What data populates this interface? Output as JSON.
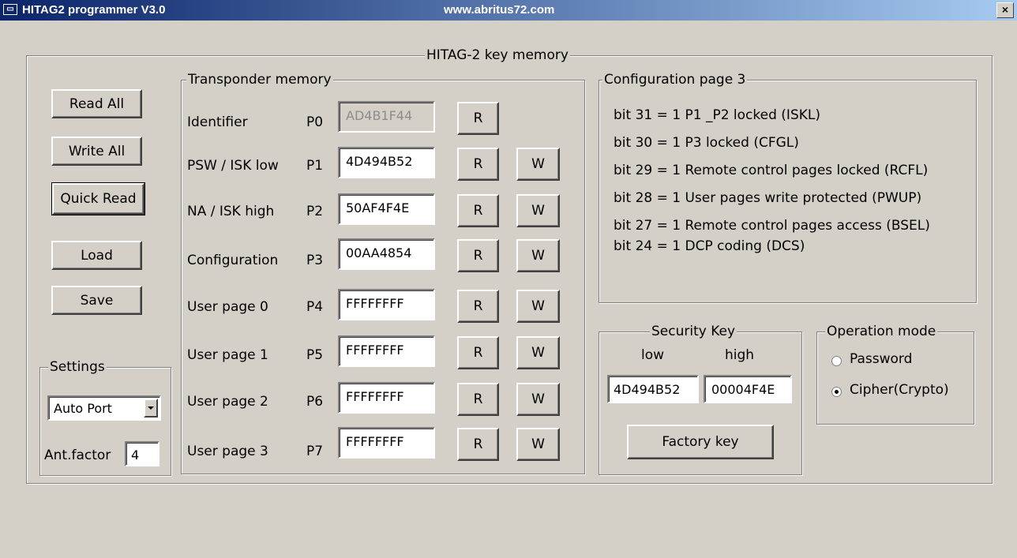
{
  "window": {
    "title": "HITAG2 programmer V3.0",
    "url": "www.abritus72.com",
    "close": "×"
  },
  "main": {
    "legend": "HITAG-2 key memory"
  },
  "left": {
    "read_all": "Read All",
    "write_all": "Write All",
    "quick_read": "Quick Read",
    "load": "Load",
    "save": "Save"
  },
  "settings": {
    "legend": "Settings",
    "port": "Auto Port",
    "ant_label": "Ant.factor",
    "ant_value": "4"
  },
  "transponder": {
    "legend": "Transponder memory",
    "read_label": "R",
    "write_label": "W",
    "rows": [
      {
        "name": "Identifier",
        "page": "P0",
        "value": "AD4B1F44"
      },
      {
        "name": "PSW / ISK low",
        "page": "P1",
        "value": "4D494B52"
      },
      {
        "name": "NA / ISK high",
        "page": "P2",
        "value": "50AF4F4E"
      },
      {
        "name": "Configuration",
        "page": "P3",
        "value": "00AA4854"
      },
      {
        "name": "User page 0",
        "page": "P4",
        "value": "FFFFFFFF"
      },
      {
        "name": "User page 1",
        "page": "P5",
        "value": "FFFFFFFF"
      },
      {
        "name": "User page 2",
        "page": "P6",
        "value": "FFFFFFFF"
      },
      {
        "name": "User page 3",
        "page": "P7",
        "value": "FFFFFFFF"
      }
    ]
  },
  "config": {
    "legend": "Configuration page 3",
    "lines": [
      "bit 31 = 1 P1 _P2 locked (ISKL)",
      "bit 30 = 1 P3 locked (CFGL)",
      "bit 29 = 1 Remote control pages locked (RCFL)",
      "bit 28 = 1 User pages write protected (PWUP)",
      "bit 27 = 1 Remote control pages access (BSEL)",
      "bit 24 = 1 DCP coding (DCS)"
    ]
  },
  "security": {
    "legend": "Security Key",
    "low_label": "low",
    "high_label": "high",
    "low_value": "4D494B52",
    "high_value": "00004F4E",
    "factory": "Factory key"
  },
  "mode": {
    "legend": "Operation mode",
    "password": "Password",
    "cipher": "Cipher(Crypto)",
    "selected": "cipher"
  }
}
